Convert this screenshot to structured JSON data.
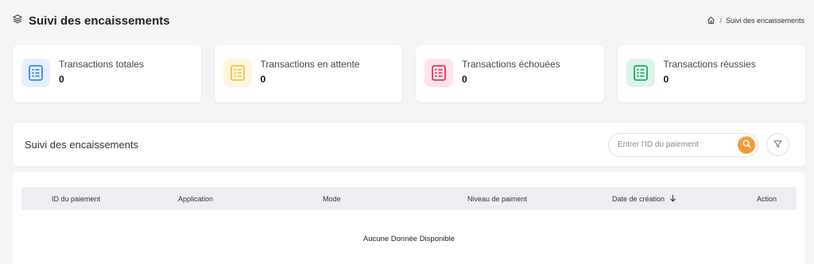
{
  "header": {
    "title": "Suivi des encaissements",
    "breadcrumb": {
      "separator": "/",
      "current": "Suivi des encaissements"
    }
  },
  "cards": [
    {
      "label": "Transactions totales",
      "value": "0",
      "color": "#3b82f6",
      "bg": "#e5efff",
      "icon": "list-icon"
    },
    {
      "label": "Transactions en attente",
      "value": "0",
      "color": "#f5c142",
      "bg": "#fff6dc",
      "icon": "list-icon"
    },
    {
      "label": "Transactions échouées",
      "value": "0",
      "color": "#e5335c",
      "bg": "#fde3ea",
      "icon": "list-icon"
    },
    {
      "label": "Transactions réussies",
      "value": "0",
      "color": "#1fa86b",
      "bg": "#dcf5e8",
      "icon": "list-icon"
    }
  ],
  "panel": {
    "title": "Suivi des encaissements",
    "search_placeholder": "Entrer l'ID du paiement",
    "accent": "#f59a3a"
  },
  "table": {
    "columns": [
      "ID du paiement",
      "Application",
      "Mode",
      "Niveau de paiment",
      "Date de création",
      "Action"
    ],
    "sort_icon": "arrow-down-icon",
    "empty_text": "Aucune Donnée Disponible"
  }
}
